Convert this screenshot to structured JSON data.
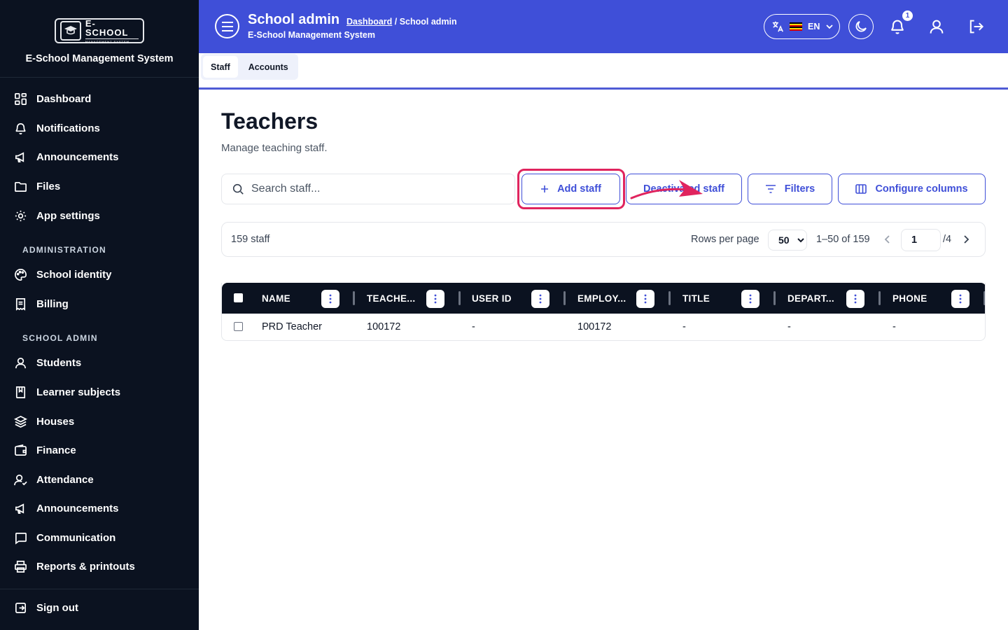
{
  "sidebar": {
    "logo_main": "E-SCHOOL",
    "logo_sub": "MANAGEMENT SYSTEM",
    "title": "E-School Management System",
    "items": [
      {
        "label": "Dashboard"
      },
      {
        "label": "Notifications"
      },
      {
        "label": "Announcements"
      },
      {
        "label": "Files"
      },
      {
        "label": "App settings"
      }
    ],
    "section_admin": "ADMINISTRATION",
    "admin_items": [
      {
        "label": "School identity"
      },
      {
        "label": "Billing"
      }
    ],
    "section_school": "SCHOOL ADMIN",
    "school_items": [
      {
        "label": "Students"
      },
      {
        "label": "Learner subjects"
      },
      {
        "label": "Houses"
      },
      {
        "label": "Finance"
      },
      {
        "label": "Attendance"
      },
      {
        "label": "Announcements"
      },
      {
        "label": "Communication"
      },
      {
        "label": "Reports & printouts"
      }
    ],
    "sign_out": "Sign out"
  },
  "header": {
    "title": "School admin",
    "crumb_link": "Dashboard",
    "crumb_rest": " / School admin",
    "subtitle": "E-School Management System",
    "lang": "EN",
    "notification_count": "1",
    "color": "#3f4fd8"
  },
  "tabs": [
    {
      "label": "Staff",
      "active": true
    },
    {
      "label": "Accounts",
      "active": false
    }
  ],
  "main": {
    "title": "Teachers",
    "description": "Manage teaching staff.",
    "search_placeholder": "Search staff...",
    "add_button": "Add staff",
    "deactivated_button": "Deactivated staff",
    "filters_button": "Filters",
    "configure_button": "Configure columns"
  },
  "pager": {
    "count": "159 staff",
    "rows_per_page_label": "Rows per page",
    "rows_per_page": "50",
    "rows_options": [
      "50"
    ],
    "range": "1–50 of 159",
    "page": "1",
    "total_pages": "/4"
  },
  "table": {
    "columns": [
      "NAME",
      "TEACHE...",
      "USER ID",
      "EMPLOY...",
      "TITLE",
      "DEPART...",
      "PHONE"
    ],
    "rows": [
      [
        "PRD Teacher",
        "100172",
        "-",
        "100172",
        "-",
        "-",
        "-"
      ]
    ]
  }
}
